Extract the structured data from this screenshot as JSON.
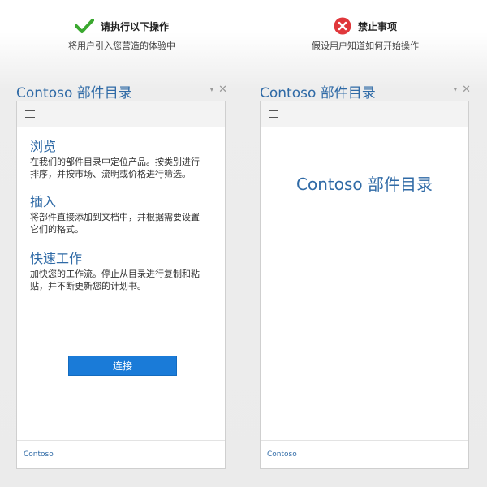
{
  "colors": {
    "accent": "#2f6aa6",
    "button": "#1a7bd8",
    "check": "#3aa82f",
    "error": "#e0373b",
    "divider": "#d03a8f"
  },
  "left": {
    "guide_icon": "check-icon",
    "guide_title": "请执行以下操作",
    "guide_sub": "将用户引入您营造的体验中",
    "pane_title": "Contoso 部件目录",
    "features": [
      {
        "title": "浏览",
        "line1": "在我们的部件目录中定位产品。按类别进行",
        "line2": "排序，并按市场、流明或价格进行筛选。"
      },
      {
        "title": "插入",
        "line1": "将部件直接添加到文档中，并根据需要设置",
        "line2": "它们的格式。"
      },
      {
        "title": "快速工作",
        "line1": "加快您的工作流。停止从目录进行复制和粘",
        "line2": "贴，并不断更新您的计划书。"
      }
    ],
    "button_label": "连接",
    "footer": "Contoso"
  },
  "right": {
    "guide_icon": "x-icon",
    "guide_title": "禁止事项",
    "guide_sub": "假设用户知道如何开始操作",
    "pane_title": "Contoso 部件目录",
    "center_title": "Contoso 部件目录",
    "footer": "Contoso"
  },
  "icons": {
    "dropdown": "▾",
    "close": "✕"
  }
}
